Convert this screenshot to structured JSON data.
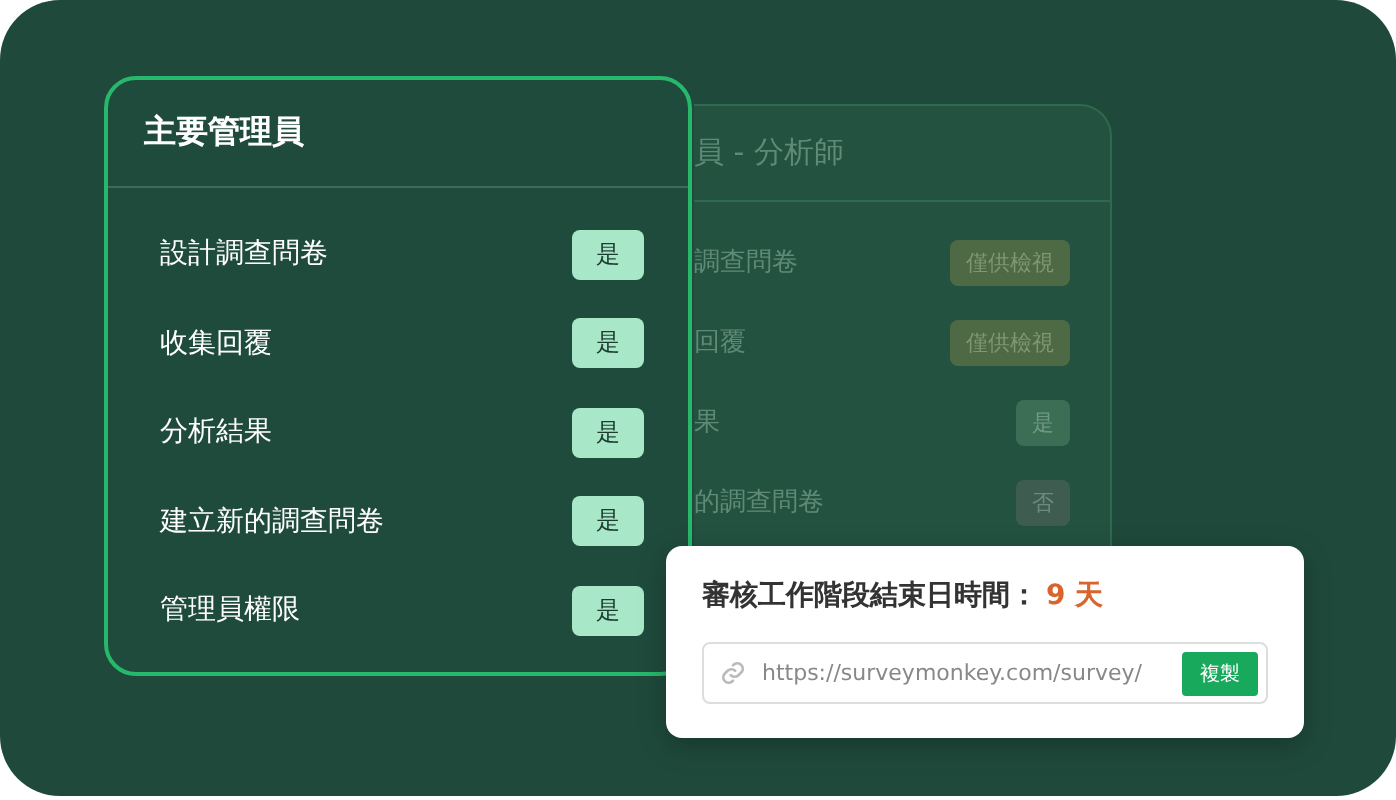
{
  "main_card": {
    "title": "主要管理員",
    "rows": [
      {
        "label": "設計調查問卷",
        "value": "是"
      },
      {
        "label": "收集回覆",
        "value": "是"
      },
      {
        "label": "分析結果",
        "value": "是"
      },
      {
        "label": "建立新的調查問卷",
        "value": "是"
      },
      {
        "label": "管理員權限",
        "value": "是"
      }
    ]
  },
  "back_card": {
    "title": "員 - 分析師",
    "rows": [
      {
        "label": "調查問卷",
        "value": "僅供檢視",
        "kind": "view"
      },
      {
        "label": "回覆",
        "value": "僅供檢視",
        "kind": "view"
      },
      {
        "label": "果",
        "value": "是",
        "kind": "yes"
      },
      {
        "label": "的調查問卷",
        "value": "否",
        "kind": "no"
      }
    ]
  },
  "popup": {
    "label": "審核工作階段結束日時間：",
    "days": "9 天",
    "link": "https://surveymonkey.com/survey/",
    "copy_button": "複製"
  }
}
